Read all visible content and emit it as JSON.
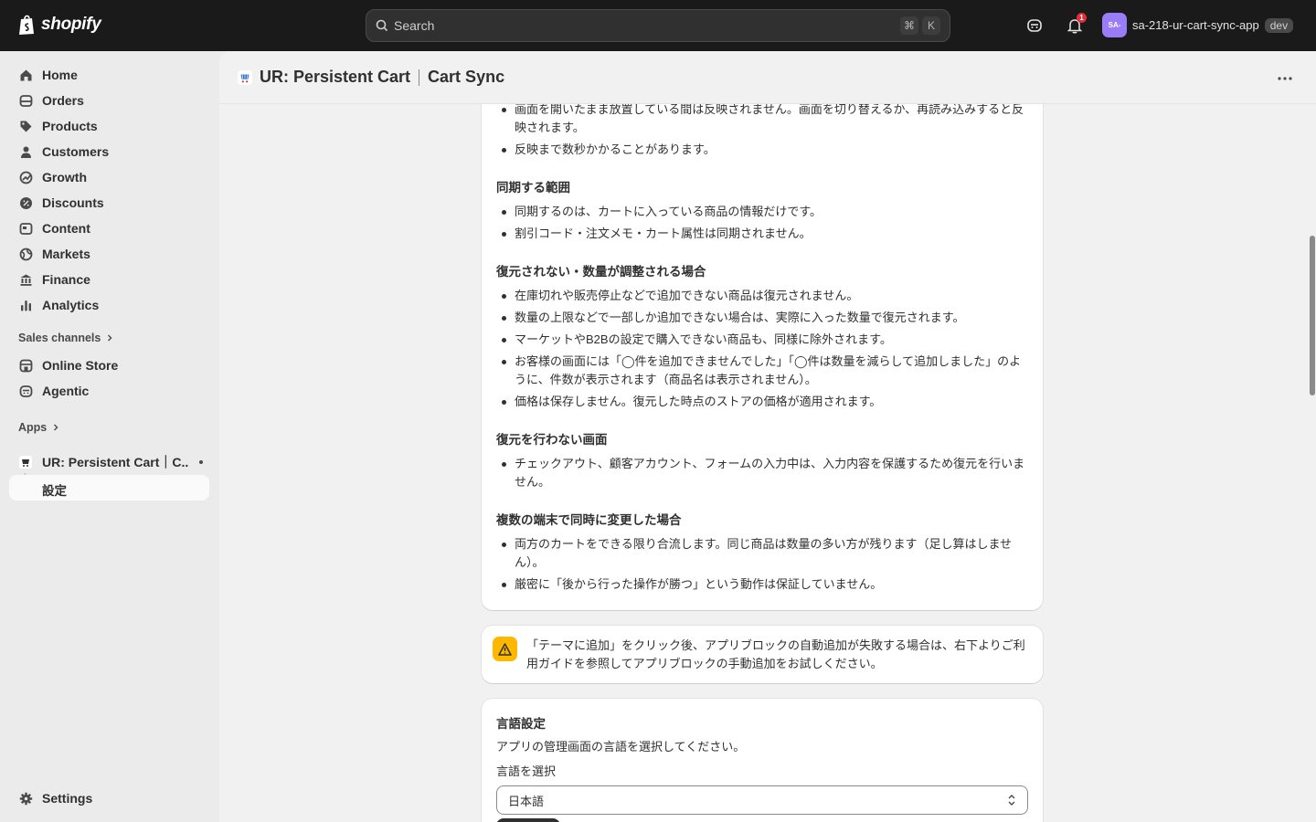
{
  "topbar": {
    "logo_text": "shopify",
    "search_placeholder": "Search",
    "shortcut_cmd": "⌘",
    "shortcut_key": "K",
    "notification_count": "1",
    "avatar_text": "SA-",
    "store_name": "sa-218-ur-cart-sync-app",
    "env_badge": "dev"
  },
  "sidebar": {
    "items": [
      {
        "label": "Home",
        "icon": "home-icon"
      },
      {
        "label": "Orders",
        "icon": "orders-icon"
      },
      {
        "label": "Products",
        "icon": "tag-icon"
      },
      {
        "label": "Customers",
        "icon": "person-icon"
      },
      {
        "label": "Growth",
        "icon": "growth-icon"
      },
      {
        "label": "Discounts",
        "icon": "discount-icon"
      },
      {
        "label": "Content",
        "icon": "content-icon"
      },
      {
        "label": "Markets",
        "icon": "globe-icon"
      },
      {
        "label": "Finance",
        "icon": "bank-icon"
      },
      {
        "label": "Analytics",
        "icon": "chart-icon"
      }
    ],
    "sales_channels_title": "Sales channels",
    "channels": [
      {
        "label": "Online Store",
        "icon": "store-icon"
      },
      {
        "label": "Agentic",
        "icon": "agentic-icon"
      }
    ],
    "apps_title": "Apps",
    "app_name": "UR: Persistent Cart｜C...",
    "app_sub": "設定",
    "settings_label": "Settings"
  },
  "page": {
    "title_main": "UR: Persistent Cart",
    "title_sub": "Cart Sync"
  },
  "content": {
    "intro_items": [
      "画面を開いたまま放置している間は反映されません。画面を切り替えるか、再読み込みすると反映されます。",
      "反映まで数秒かかることがあります。"
    ],
    "sections": [
      {
        "heading": "同期する範囲",
        "items": [
          "同期するのは、カートに入っている商品の情報だけです。",
          "割引コード・注文メモ・カート属性は同期されません。"
        ]
      },
      {
        "heading": "復元されない・数量が調整される場合",
        "items": [
          "在庫切れや販売停止などで追加できない商品は復元されません。",
          "数量の上限などで一部しか追加できない場合は、実際に入った数量で復元されます。",
          "マーケットやB2Bの設定で購入できない商品も、同様に除外されます。",
          "お客様の画面には「◯件を追加できませんでした」「◯件は数量を減らして追加しました」のように、件数が表示されます（商品名は表示されません）。",
          "価格は保存しません。復元した時点のストアの価格が適用されます。"
        ]
      },
      {
        "heading": "復元を行わない画面",
        "items": [
          "チェックアウト、顧客アカウント、フォームの入力中は、入力内容を保護するため復元を行いません。"
        ]
      },
      {
        "heading": "複数の端末で同時に変更した場合",
        "items": [
          "両方のカートをできる限り合流します。同じ商品は数量の多い方が残ります（足し算はしません）。",
          "厳密に「後から行った操作が勝つ」という動作は保証していません。"
        ]
      }
    ]
  },
  "warning": {
    "text": "「テーマに追加」をクリック後、アプリブロックの自動追加が失敗する場合は、右下よりご利用ガイドを参照してアプリブロックの手動追加をお試しください。"
  },
  "language": {
    "title": "言語設定",
    "description": "アプリの管理画面の言語を選択してください。",
    "select_label": "言語を選択",
    "selected": "日本語"
  },
  "colors": {
    "topbar": "#1a1a1a",
    "warning": "#ffb800",
    "notification": "#e22c38",
    "avatar": "#9b7cf8"
  }
}
